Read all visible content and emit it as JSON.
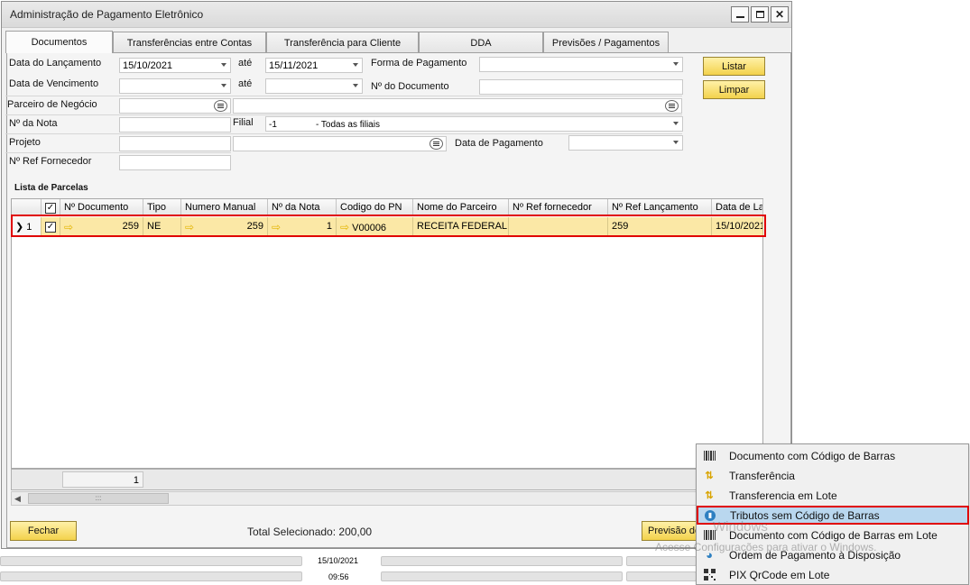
{
  "window": {
    "title": "Administração de Pagamento Eletrônico"
  },
  "tabs": [
    "Documentos",
    "Transferências entre Contas",
    "Transferência para Cliente",
    "DDA",
    "Previsões / Pagamentos"
  ],
  "filters": {
    "data_lancamento_label": "Data do Lançamento",
    "data_lancamento_from": "15/10/2021",
    "ate1": "até",
    "data_lancamento_to": "15/11/2021",
    "forma_pagamento_label": "Forma de Pagamento",
    "data_vencimento_label": "Data de Vencimento",
    "ate2": "até",
    "num_documento_label": "Nº do Documento",
    "parceiro_label": "Parceiro de Negócio",
    "num_nota_label": "Nº da Nota",
    "filial_label": "Filial",
    "filial_code": "-1",
    "filial_value": "- Todas as filiais",
    "projeto_label": "Projeto",
    "data_pagamento_label": "Data de Pagamento",
    "ref_fornecedor_label": "Nº Ref Fornecedor"
  },
  "buttons": {
    "listar": "Listar",
    "limpar": "Limpar",
    "fechar": "Fechar",
    "previsao": "Previsão de"
  },
  "grid": {
    "section_label": "Lista de Parcelas",
    "columns": [
      "Nº Documento",
      "Tipo",
      "Numero Manual",
      "Nº da Nota",
      "Codigo do PN",
      "Nome do Parceiro",
      "Nº Ref fornecedor",
      "Nº Ref Lançamento",
      "Data de La"
    ],
    "row": {
      "index": "1",
      "num_documento": "259",
      "tipo": "NE",
      "numero_manual": "259",
      "num_nota": "1",
      "codigo_pn": "V00006",
      "nome_parceiro": "RECEITA FEDERAL",
      "ref_fornecedor": "",
      "ref_lancamento": "259",
      "data": "15/10/2021"
    },
    "footer_count": "1",
    "scroll_grip": ":::"
  },
  "total_selecionado": "Total Selecionado: 200,00",
  "context_menu": [
    "Documento com Código de Barras",
    "Transferência",
    "Transferencia em Lote",
    "Tributos sem Código de Barras",
    "Documento com Código de Barras em Lote",
    "Ordem de Pagamento à Disposição",
    "PIX QrCode em Lote"
  ],
  "watermark": {
    "line1": "Windows",
    "line2": "Acesse Configurações para ativar o Windows."
  },
  "statusbar": {
    "date": "15/10/2021",
    "time": "09:56"
  },
  "colors": {
    "highlight_border": "#e00000",
    "row_fill": "#fbe8a6",
    "menu_selected": "#b9d7ef",
    "button_yellow": "#f3d24c"
  }
}
